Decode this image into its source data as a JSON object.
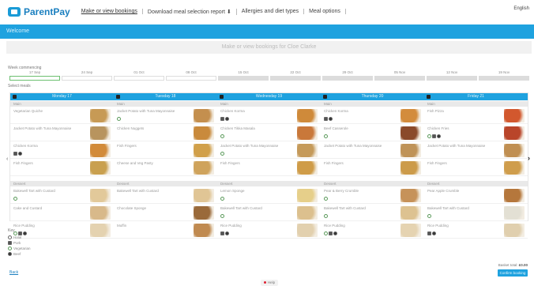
{
  "nav": {
    "brand": "ParentPay",
    "links": [
      "Make or view bookings",
      "Download meal selection report ⬇",
      "Allergies and diet types",
      "Meal options"
    ],
    "language": "English"
  },
  "banner": {
    "text": "Welcome"
  },
  "page": {
    "title": "Make or view bookings for Cloe Clarke"
  },
  "weeks": {
    "label": "Week commencing",
    "items": [
      {
        "label": "17 Sep",
        "selected": true,
        "grey": false
      },
      {
        "label": "24 Sep",
        "selected": false,
        "grey": false
      },
      {
        "label": "01 Oct",
        "selected": false,
        "grey": false
      },
      {
        "label": "08 Oct",
        "selected": false,
        "grey": false
      },
      {
        "label": "15 Oct",
        "selected": false,
        "grey": true
      },
      {
        "label": "22 Oct",
        "selected": false,
        "grey": true
      },
      {
        "label": "29 Oct",
        "selected": false,
        "grey": true
      },
      {
        "label": "05 Nov",
        "selected": false,
        "grey": true
      },
      {
        "label": "12 Nov",
        "selected": false,
        "grey": true
      },
      {
        "label": "19 Nov",
        "selected": false,
        "grey": true
      }
    ]
  },
  "select_label": "Select meals",
  "days": [
    {
      "name": "Monday 17",
      "main_label": "Main",
      "dessert_label": "Dessert",
      "mains": [
        {
          "name": "Vegetarian Quiche",
          "icons": [],
          "color": "#c79a55"
        },
        {
          "name": "Jacket Potato with Tuna Mayonnaise",
          "icons": [],
          "color": "#b8945e"
        },
        {
          "name": "Chicken Korma",
          "icons": [
            "h",
            "s"
          ],
          "color": "#d28b3a"
        },
        {
          "name": "Fish Fingers",
          "icons": [],
          "color": "#c9a04f"
        }
      ],
      "desserts": [
        {
          "name": "Bakewell Tart with Custard",
          "icons": [
            "v"
          ],
          "color": "#e2c99a"
        },
        {
          "name": "Cake and Custard",
          "icons": [],
          "color": "#d8b98a"
        },
        {
          "name": "Rice Pudding",
          "icons": [
            "v",
            "h",
            "s"
          ],
          "color": "#e4d2b0"
        }
      ]
    },
    {
      "name": "Tuesday 18",
      "main_label": "Main",
      "dessert_label": "Dessert",
      "mains": [
        {
          "name": "Jacket Potato with Tuna Mayonnaise",
          "icons": [
            "v"
          ],
          "color": "#c48f4e"
        },
        {
          "name": "Chicken Nuggets",
          "icons": [],
          "color": "#c98a3c"
        },
        {
          "name": "Fish Fingers",
          "icons": [],
          "color": "#d1a04a"
        },
        {
          "name": "Cheese and Veg Pasty",
          "icons": [],
          "color": "#cfa35c"
        }
      ],
      "desserts": [
        {
          "name": "Bakewell Tart with Custard",
          "icons": [],
          "color": "#e0c595"
        },
        {
          "name": "Chocolate Sponge",
          "icons": [],
          "color": "#9a6a3a"
        },
        {
          "name": "Muffin",
          "icons": [],
          "color": "#c08a50"
        }
      ]
    },
    {
      "name": "Wednesday 19",
      "main_label": "Main",
      "dessert_label": "Dessert",
      "mains": [
        {
          "name": "Chicken Korma",
          "icons": [
            "h",
            "s"
          ],
          "color": "#cf8a3a"
        },
        {
          "name": "Chicken Tikka Masala",
          "icons": [
            "v"
          ],
          "color": "#c9783a"
        },
        {
          "name": "Jacket Potato with Tuna Mayonnaise",
          "icons": [
            "v"
          ],
          "color": "#c59a5a"
        },
        {
          "name": "Fish Fingers",
          "icons": [],
          "color": "#cf9c48"
        }
      ],
      "desserts": [
        {
          "name": "Lemon Sponge",
          "icons": [
            "v"
          ],
          "color": "#e6cf8a"
        },
        {
          "name": "Bakewell Tart with Custard",
          "icons": [
            "v"
          ],
          "color": "#dcc08e"
        },
        {
          "name": "Rice Pudding",
          "icons": [
            "h",
            "s"
          ],
          "color": "#e2d0ae"
        }
      ]
    },
    {
      "name": "Thursday 20",
      "main_label": "Main",
      "dessert_label": "Dessert",
      "mains": [
        {
          "name": "Chicken Korma",
          "icons": [
            "h",
            "s"
          ],
          "color": "#d38c3c"
        },
        {
          "name": "Beef Casserole",
          "icons": [
            "v"
          ],
          "color": "#8a4a2a"
        },
        {
          "name": "Jacket Potato with Tuna Mayonnaise",
          "icons": [],
          "color": "#bf9358"
        },
        {
          "name": "Fish Fingers",
          "icons": [],
          "color": "#cc9b4a"
        }
      ],
      "desserts": [
        {
          "name": "Pear & Berry Crumble",
          "icons": [
            "v"
          ],
          "color": "#c6925a"
        },
        {
          "name": "Bakewell Tart with Custard",
          "icons": [
            "v"
          ],
          "color": "#ddc291"
        },
        {
          "name": "Rice Pudding",
          "icons": [
            "v",
            "h",
            "s"
          ],
          "color": "#e5d3b1"
        }
      ]
    },
    {
      "name": "Friday 21",
      "main_label": "Main",
      "dessert_label": "Dessert",
      "mains": [
        {
          "name": "Fish Pizza",
          "icons": [],
          "color": "#d2582e"
        },
        {
          "name": "Chicken Fries",
          "icons": [
            "v",
            "h",
            "s"
          ],
          "color": "#b9452a"
        },
        {
          "name": "Jacket Potato with Tuna Mayonnaise",
          "icons": [],
          "color": "#c08f52"
        },
        {
          "name": "Fish Fingers",
          "icons": [],
          "color": "#cf9d4c"
        }
      ],
      "desserts": [
        {
          "name": "Pear Apple Crumble",
          "icons": [],
          "color": "#b5773c"
        },
        {
          "name": "Bakewell Tart with Custard",
          "icons": [
            "v"
          ],
          "color": "#e3e0d4"
        },
        {
          "name": "Rice Pudding",
          "icons": [
            "h",
            "s"
          ],
          "color": "#e0cfae"
        }
      ]
    }
  ],
  "key": {
    "title": "Key",
    "items": [
      {
        "icon": "o",
        "label": "Halal"
      },
      {
        "icon": "h",
        "label": "Pork"
      },
      {
        "icon": "v",
        "label": "Vegetarian"
      },
      {
        "icon": "s",
        "label": "Beef"
      }
    ]
  },
  "footer": {
    "back": "Back",
    "total_label": "Basket total:",
    "total_value": "£0.00",
    "confirm": "Confirm booking",
    "help": "Help"
  },
  "colors": {
    "accent": "#1fa2df",
    "brand": "#1a7fbf",
    "selected_week": "#6cc070"
  }
}
